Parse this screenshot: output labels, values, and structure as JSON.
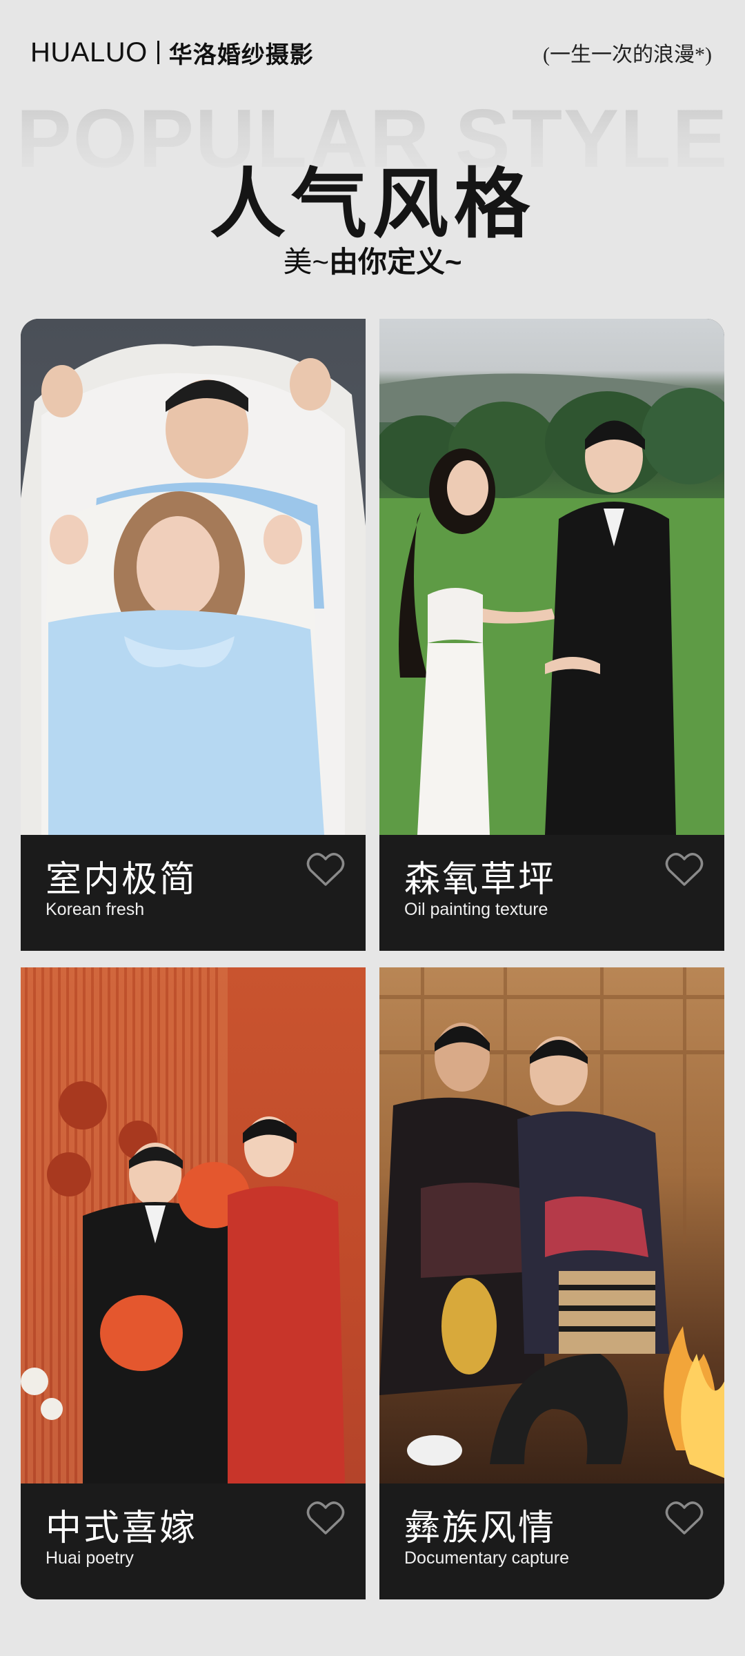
{
  "header": {
    "brand_en": "HUALUO",
    "brand_cn": "华洛婚纱摄影",
    "slogan": "(一生一次的浪漫*)"
  },
  "hero": {
    "bg_text": "POPULAR STYLE",
    "title": "人气风格",
    "subtitle_light": "美",
    "subtitle_tilde": "~",
    "subtitle_bold": "由你定义~"
  },
  "cards": [
    {
      "title": "室内极简",
      "subtitle": "Korean fresh",
      "icon": "heart-outline-icon"
    },
    {
      "title": "森氧草坪",
      "subtitle": "Oil painting texture",
      "icon": "heart-outline-icon"
    },
    {
      "title": "中式喜嫁",
      "subtitle": "Huai poetry",
      "icon": "heart-outline-icon"
    },
    {
      "title": "彝族风情",
      "subtitle": "Documentary capture",
      "icon": "heart-outline-icon"
    }
  ],
  "colors": {
    "page_bg": "#e6e6e6",
    "caption_bg": "#1b1b1b",
    "text_dark": "#111111",
    "text_light": "#ffffff"
  }
}
